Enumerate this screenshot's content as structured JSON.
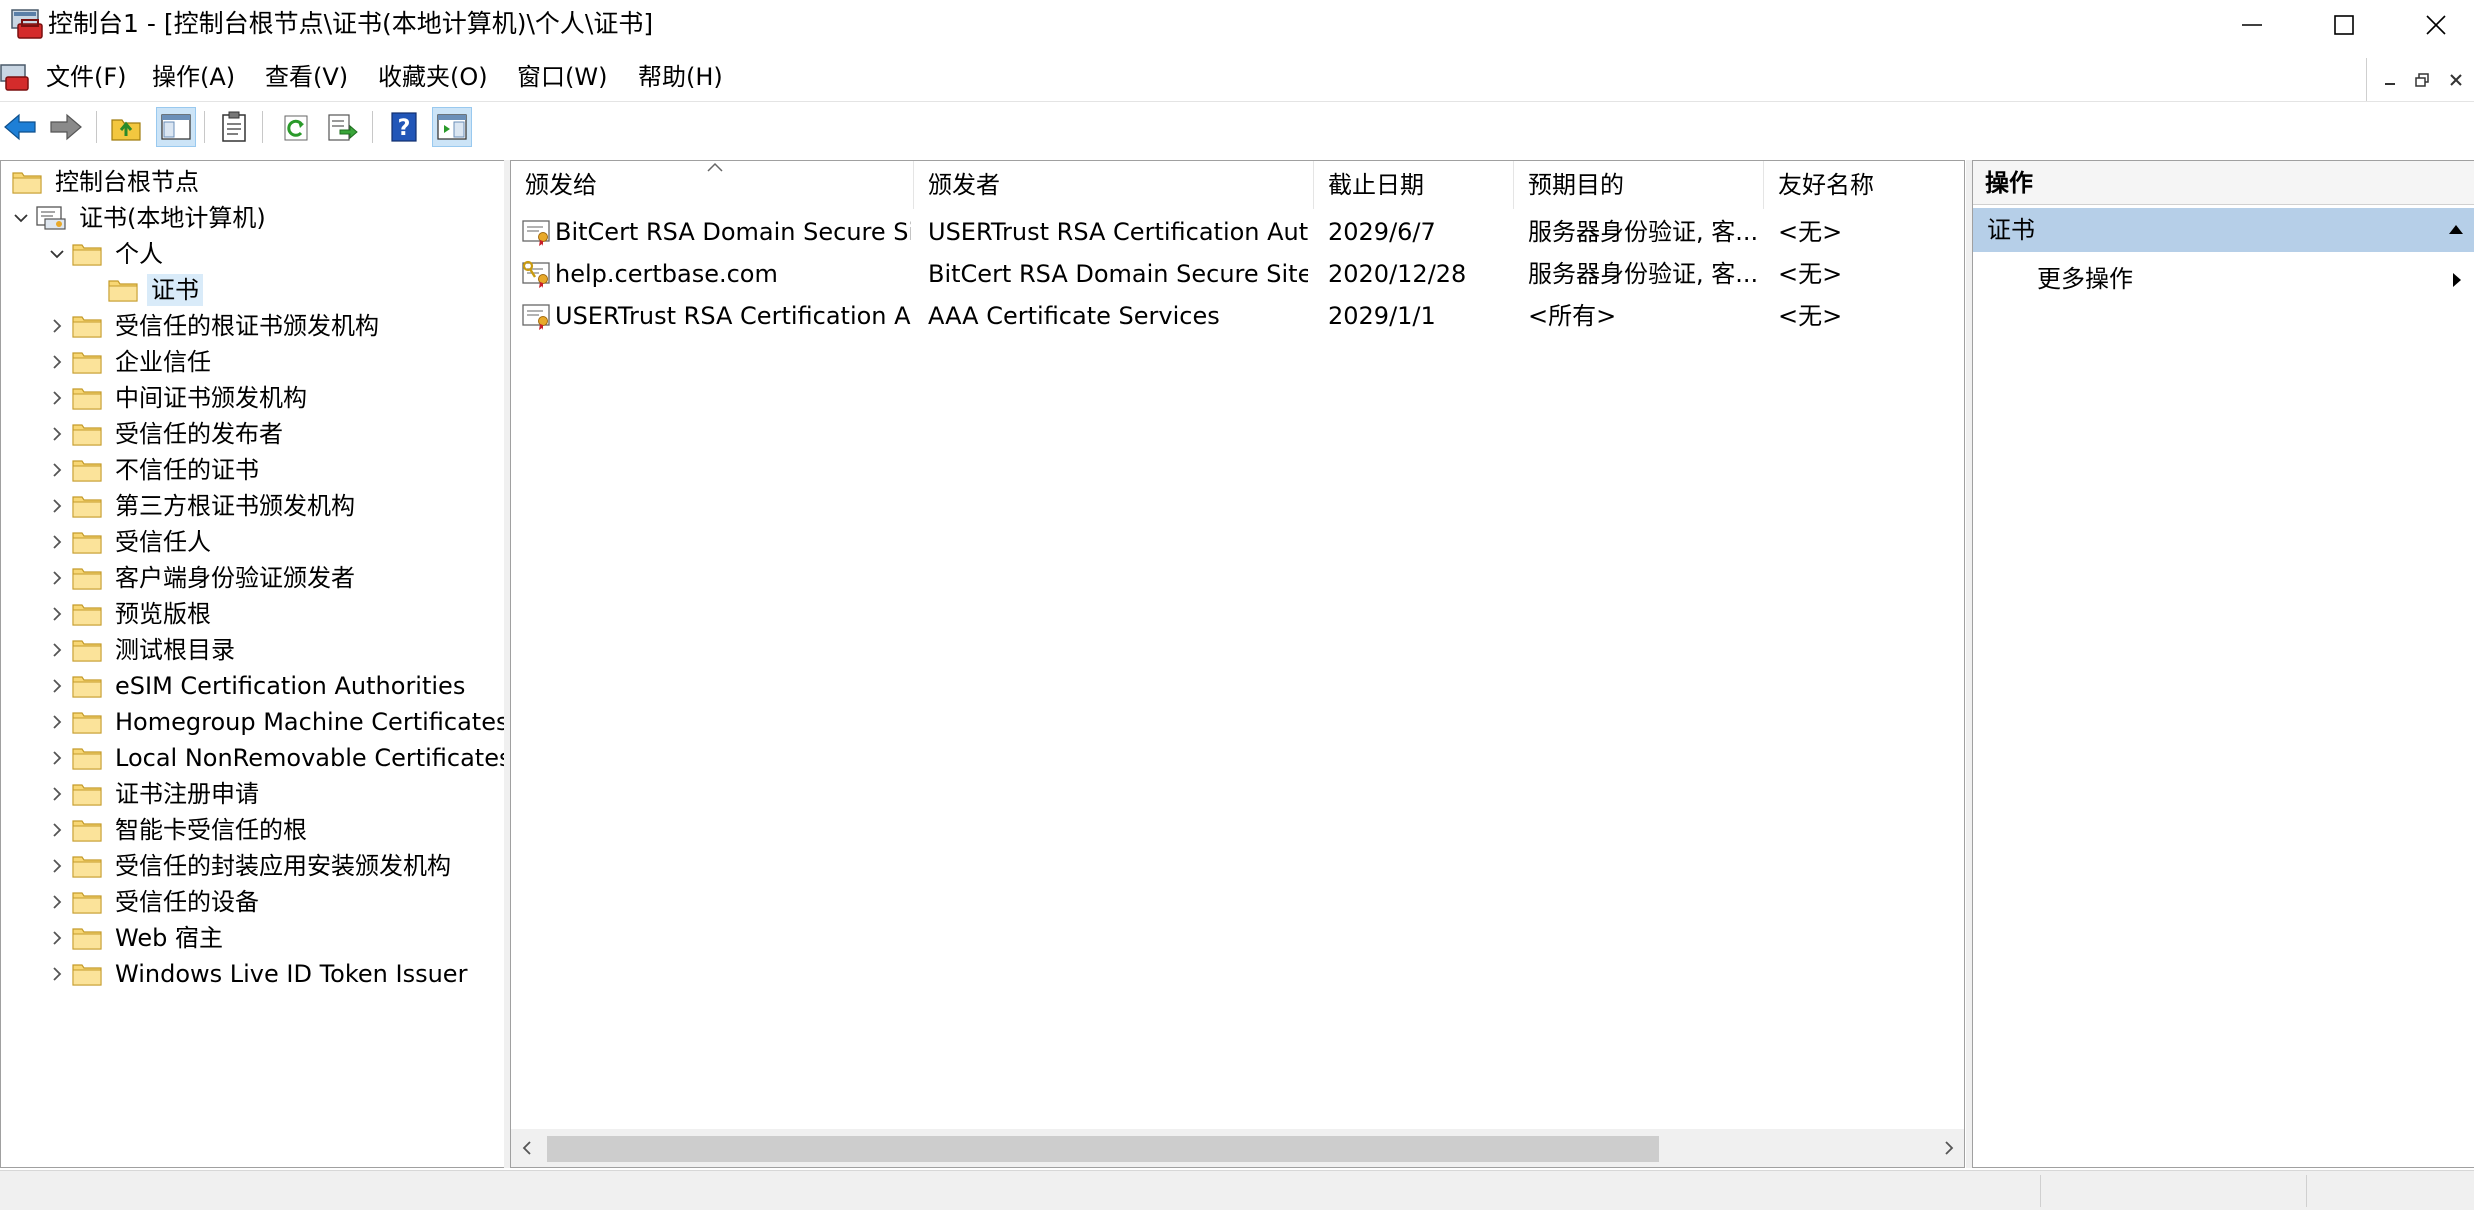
{
  "window": {
    "title": "控制台1 - [控制台根节点\\证书(本地计算机)\\个人\\证书]"
  },
  "menu": [
    "文件(F)",
    "操作(A)",
    "查看(V)",
    "收藏夹(O)",
    "窗口(W)",
    "帮助(H)"
  ],
  "tree": [
    {
      "label": "控制台根节点",
      "level": 0,
      "expander": "none"
    },
    {
      "label": "证书(本地计算机)",
      "level": 1,
      "expander": "expanded"
    },
    {
      "label": "个人",
      "level": 2,
      "expander": "expanded"
    },
    {
      "label": "证书",
      "level": 3,
      "expander": "none",
      "selected": true
    },
    {
      "label": "受信任的根证书颁发机构",
      "level": 2,
      "expander": "collapsed"
    },
    {
      "label": "企业信任",
      "level": 2,
      "expander": "collapsed"
    },
    {
      "label": "中间证书颁发机构",
      "level": 2,
      "expander": "collapsed"
    },
    {
      "label": "受信任的发布者",
      "level": 2,
      "expander": "collapsed"
    },
    {
      "label": "不信任的证书",
      "level": 2,
      "expander": "collapsed"
    },
    {
      "label": "第三方根证书颁发机构",
      "level": 2,
      "expander": "collapsed"
    },
    {
      "label": "受信任人",
      "level": 2,
      "expander": "collapsed"
    },
    {
      "label": "客户端身份验证颁发者",
      "level": 2,
      "expander": "collapsed"
    },
    {
      "label": "预览版根",
      "level": 2,
      "expander": "collapsed"
    },
    {
      "label": "测试根目录",
      "level": 2,
      "expander": "collapsed"
    },
    {
      "label": "eSIM Certification Authorities",
      "level": 2,
      "expander": "collapsed"
    },
    {
      "label": "Homegroup Machine Certificates",
      "level": 2,
      "expander": "collapsed"
    },
    {
      "label": "Local NonRemovable Certificates",
      "level": 2,
      "expander": "collapsed"
    },
    {
      "label": "证书注册申请",
      "level": 2,
      "expander": "collapsed"
    },
    {
      "label": "智能卡受信任的根",
      "level": 2,
      "expander": "collapsed"
    },
    {
      "label": "受信任的封装应用安装颁发机构",
      "level": 2,
      "expander": "collapsed"
    },
    {
      "label": "受信任的设备",
      "level": 2,
      "expander": "collapsed"
    },
    {
      "label": "Web 宿主",
      "level": 2,
      "expander": "collapsed"
    },
    {
      "label": "Windows Live ID Token Issuer",
      "level": 2,
      "expander": "collapsed"
    }
  ],
  "list": {
    "columns": [
      "颁发给",
      "颁发者",
      "截止日期",
      "预期目的",
      "友好名称"
    ],
    "rows": [
      {
        "issued_to": "BitCert RSA Domain Secure Sit...",
        "issuer": "USERTrust RSA Certification Aut...",
        "expires": "2029/6/7",
        "purpose": "服务器身份验证, 客...",
        "friendly": "<无>",
        "has_key": false
      },
      {
        "issued_to": "help.certbase.com",
        "issuer": "BitCert RSA Domain Secure Site ...",
        "expires": "2020/12/28",
        "purpose": "服务器身份验证, 客...",
        "friendly": "<无>",
        "has_key": true
      },
      {
        "issued_to": "USERTrust RSA Certification A...",
        "issuer": "AAA Certificate Services",
        "expires": "2029/1/1",
        "purpose": "<所有>",
        "friendly": "<无>",
        "has_key": false
      }
    ]
  },
  "actions": {
    "header": "操作",
    "section": "证书",
    "items": [
      "更多操作"
    ]
  },
  "colors": {
    "selection": "#d9ebf9",
    "actions_section": "#b6cfe8",
    "toolbar_active": "#cce4f7",
    "folder": "#f8d775"
  }
}
